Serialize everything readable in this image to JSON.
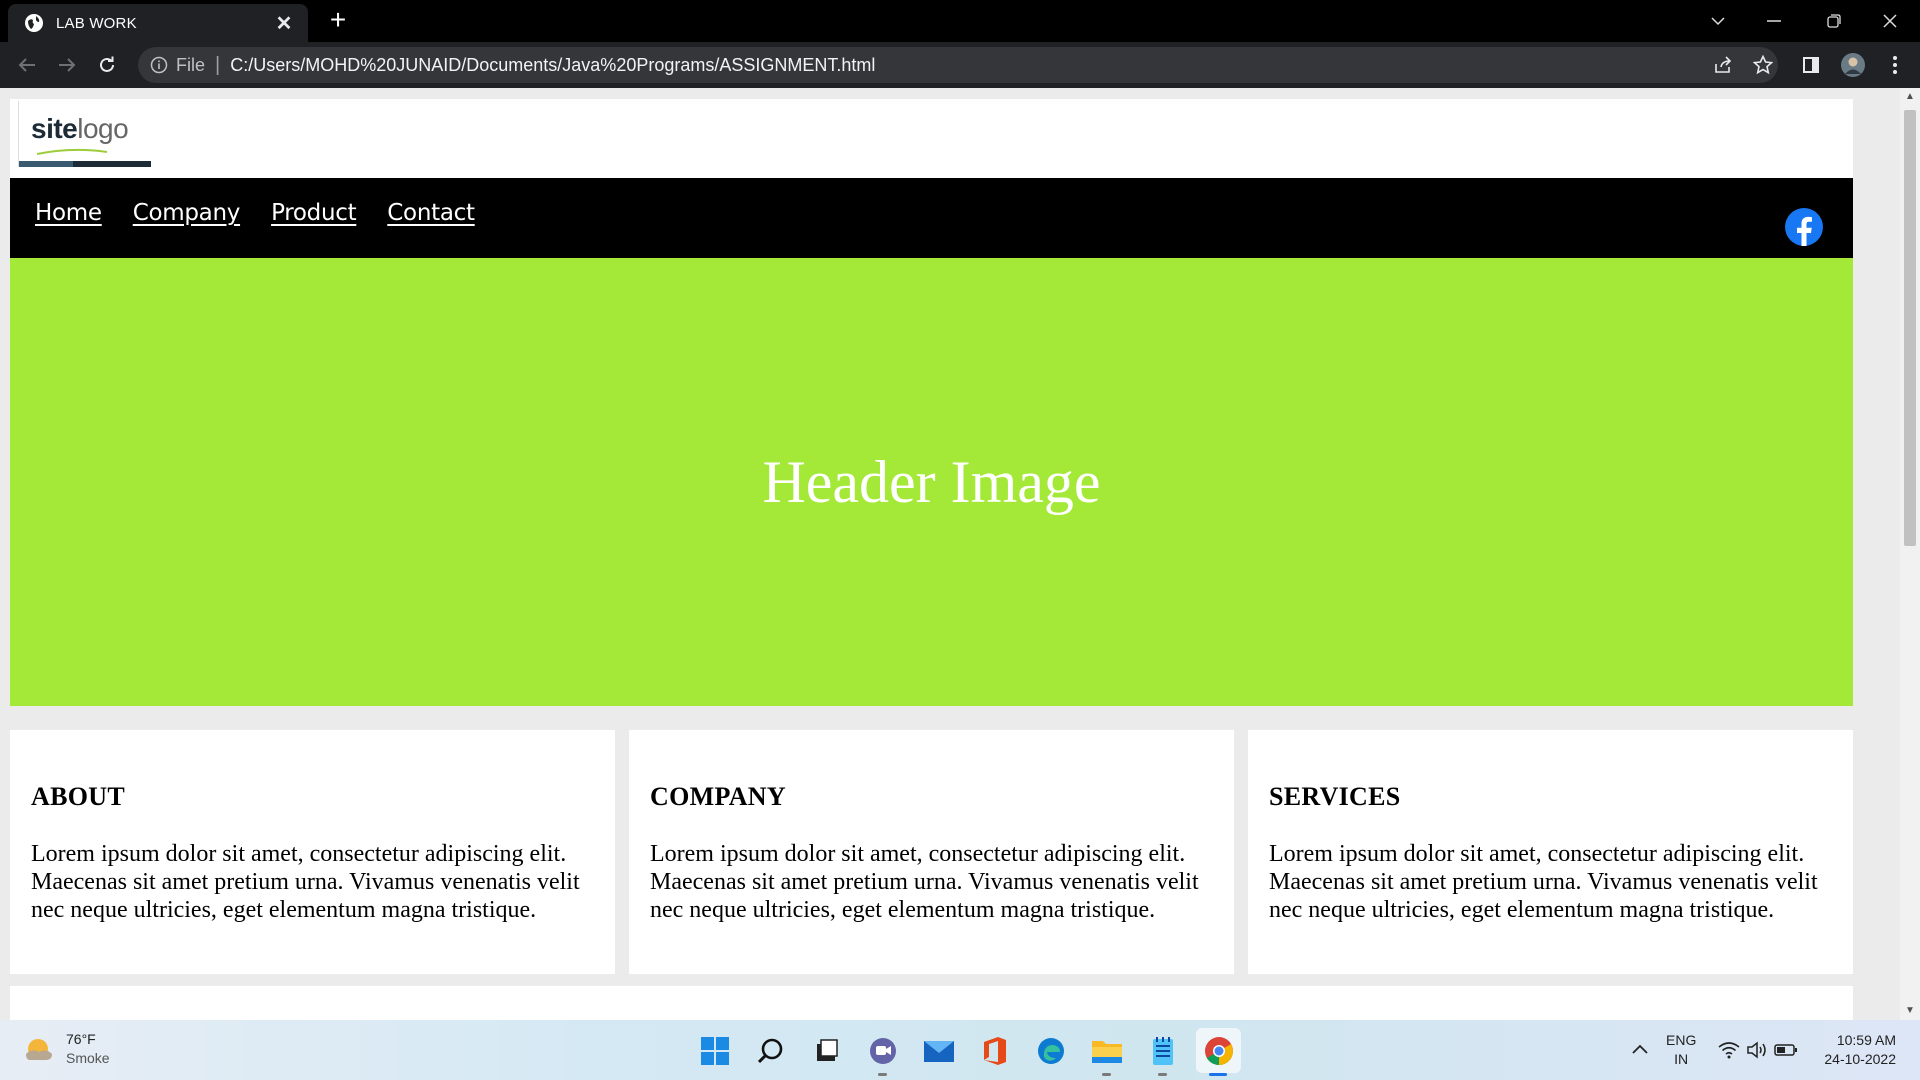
{
  "browser": {
    "tab_title": "LAB WORK",
    "new_tab_symbol": "+",
    "close_symbol": "✕",
    "omnibox": {
      "scheme_label": "File",
      "separator": "|",
      "url": "C:/Users/MOHD%20JUNAID/Documents/Java%20Programs/ASSIGNMENT.html"
    }
  },
  "site": {
    "logo": {
      "part1": "site",
      "part2": "logo"
    },
    "nav": [
      "Home",
      "Company",
      "Product",
      "Contact"
    ],
    "hero_text": "Header Image",
    "cards": [
      {
        "title": "ABOUT",
        "body": "Lorem ipsum dolor sit amet, consectetur adipiscing elit. Maecenas sit amet pretium urna. Vivamus venenatis velit nec neque ultricies, eget elementum magna tristique."
      },
      {
        "title": "COMPANY",
        "body": "Lorem ipsum dolor sit amet, consectetur adipiscing elit. Maecenas sit amet pretium urna. Vivamus venenatis velit nec neque ultricies, eget elementum magna tristique."
      },
      {
        "title": "SERVICES",
        "body": "Lorem ipsum dolor sit amet, consectetur adipiscing elit. Maecenas sit amet pretium urna. Vivamus venenatis velit nec neque ultricies, eget elementum magna tristique."
      }
    ],
    "colors": {
      "hero_bg": "#a4e937",
      "nav_bg": "#000000",
      "facebook": "#1877f2"
    }
  },
  "taskbar": {
    "weather": {
      "temp": "76°F",
      "condition": "Smoke"
    },
    "apps": [
      "start-icon",
      "search-icon",
      "task-view-icon",
      "teams-chat-icon",
      "mail-icon",
      "office-icon",
      "edge-icon",
      "file-explorer-icon",
      "notepad-icon",
      "chrome-icon"
    ],
    "language": {
      "line1": "ENG",
      "line2": "IN"
    },
    "clock": {
      "time": "10:59 AM",
      "date": "24-10-2022"
    }
  }
}
